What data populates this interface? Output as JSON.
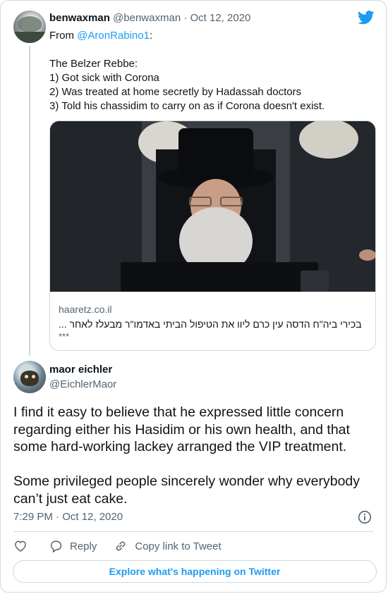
{
  "quoted_tweet": {
    "display_name": "benwaxman",
    "handle": "@benwaxman",
    "separator": "·",
    "date": "Oct 12, 2020",
    "text_prefix": "From ",
    "mention": "@AronRabino1",
    "text_suffix": ":",
    "lines": [
      "The Belzer Rebbe:",
      "1) Got sick with Corona",
      "2) Was treated at home secretly by Hadassah doctors",
      "3) Told his chassidim to carry on as if Corona doesn't exist."
    ],
    "link_card": {
      "domain": "haaretz.co.il",
      "headline": "בכירי ביה\"ח הדסה עין כרם ליוו את הטיפול הביתי באדמו\"ר מבעלז לאחר ...",
      "suffix": "***"
    }
  },
  "tweet": {
    "display_name": "maor eichler",
    "handle": "@EichlerMaor",
    "lines": [
      "I find it easy to believe that he expressed little concern",
      "regarding either his Hasidim or his own health, and that",
      "some hard-working lackey arranged the VIP treatment."
    ],
    "lines2": [
      "Some privileged people sincerely wonder why everybody",
      "can’t just eat cake."
    ],
    "timestamp": "7:29 PM · Oct 12, 2020"
  },
  "actions": {
    "like_icon": "heart-icon",
    "reply_label": "Reply",
    "copy_label": "Copy link to Tweet"
  },
  "footer": {
    "explore_label": "Explore what's happening on Twitter"
  },
  "colors": {
    "accent": "#1d9bf0",
    "secondary_text": "#536471",
    "border": "#cfd9de"
  }
}
